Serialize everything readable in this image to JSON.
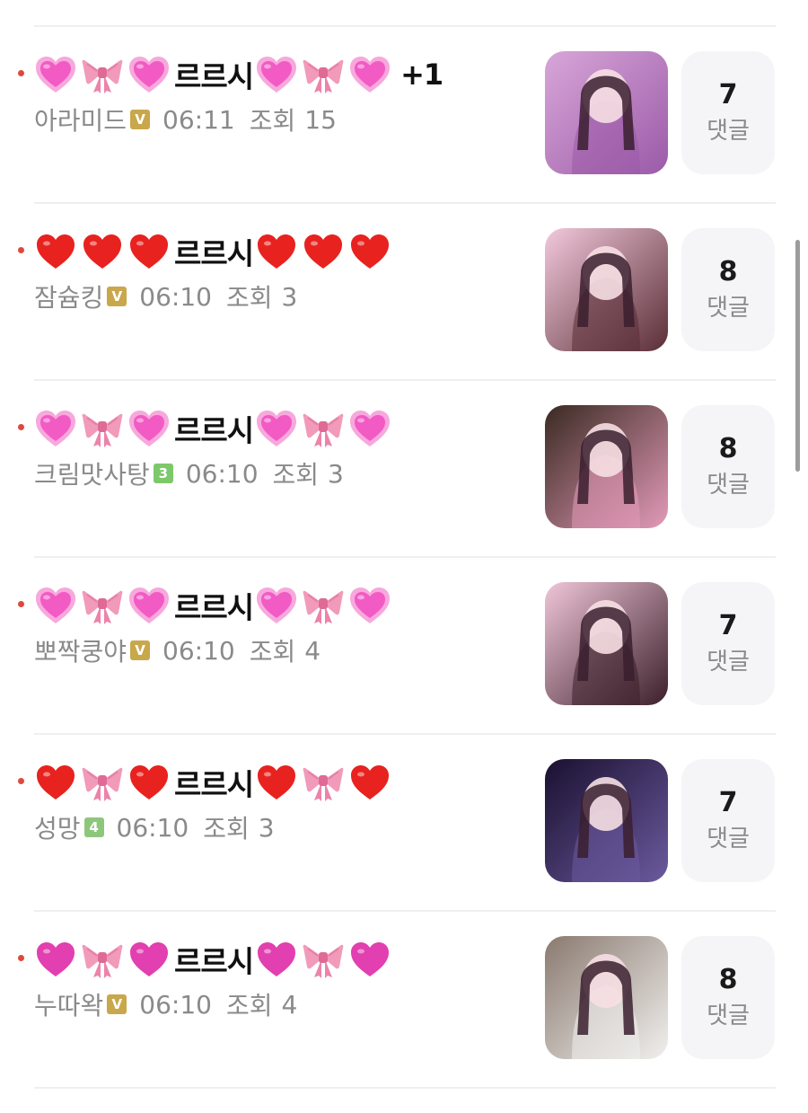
{
  "colors": {
    "unread_dot": "#e0483c",
    "meta_text": "#8a8a8a",
    "badge_v": "#c9a74b",
    "badge_3": "#7dc86a",
    "badge_4": "#8ec77b"
  },
  "comment_label": "댓글",
  "views_label": "조회",
  "posts": [
    {
      "emojis_left": [
        "pink-growing-heart",
        "pink-ribbon",
        "pink-growing-heart"
      ],
      "title_text": "르르시",
      "emojis_right": [
        "pink-growing-heart",
        "pink-ribbon",
        "pink-growing-heart"
      ],
      "extra": "+1",
      "author": "아라미드",
      "badge": "V",
      "badge_color": "#c9a74b",
      "time": "06:11",
      "views": "15",
      "comments": "7",
      "thumb_theme": [
        "#d8a6d8",
        "#9b5aa8"
      ]
    },
    {
      "emojis_left": [
        "red-heart",
        "red-heart",
        "red-heart"
      ],
      "title_text": "르르시",
      "emojis_right": [
        "red-heart",
        "red-heart",
        "red-heart"
      ],
      "extra": "",
      "author": "잠슘킹",
      "badge": "V",
      "badge_color": "#c9a74b",
      "time": "06:10",
      "views": "3",
      "comments": "8",
      "thumb_theme": [
        "#f2c9dc",
        "#5a2e36"
      ]
    },
    {
      "emojis_left": [
        "pink-growing-heart",
        "pink-ribbon",
        "pink-growing-heart"
      ],
      "title_text": "르르시",
      "emojis_right": [
        "pink-growing-heart",
        "pink-ribbon",
        "pink-growing-heart"
      ],
      "extra": "",
      "author": "크림맛사탕",
      "badge": "3",
      "badge_color": "#7dc86a",
      "time": "06:10",
      "views": "3",
      "comments": "8",
      "thumb_theme": [
        "#3a2a22",
        "#e39ab8"
      ]
    },
    {
      "emojis_left": [
        "pink-growing-heart",
        "pink-ribbon",
        "pink-growing-heart"
      ],
      "title_text": "르르시",
      "emojis_right": [
        "pink-growing-heart",
        "pink-ribbon",
        "pink-growing-heart"
      ],
      "extra": "",
      "author": "뽀짝쿵야",
      "badge": "V",
      "badge_color": "#c9a74b",
      "time": "06:10",
      "views": "4",
      "comments": "7",
      "thumb_theme": [
        "#f0c6d8",
        "#3b1f2a"
      ]
    },
    {
      "emojis_left": [
        "red-heart",
        "pink-ribbon",
        "red-heart"
      ],
      "title_text": "르르시",
      "emojis_right": [
        "red-heart",
        "pink-ribbon",
        "red-heart"
      ],
      "extra": "",
      "author": "성망",
      "badge": "4",
      "badge_color": "#8ec77b",
      "time": "06:10",
      "views": "3",
      "comments": "7",
      "thumb_theme": [
        "#1a1030",
        "#6b5a9e"
      ]
    },
    {
      "emojis_left": [
        "magenta-heart",
        "pink-ribbon",
        "magenta-heart"
      ],
      "title_text": "르르시",
      "emojis_right": [
        "magenta-heart",
        "pink-ribbon",
        "magenta-heart"
      ],
      "extra": "",
      "author": "누따왁",
      "badge": "V",
      "badge_color": "#c9a74b",
      "time": "06:10",
      "views": "4",
      "comments": "8",
      "thumb_theme": [
        "#8a7a70",
        "#f1f0ee"
      ]
    }
  ]
}
